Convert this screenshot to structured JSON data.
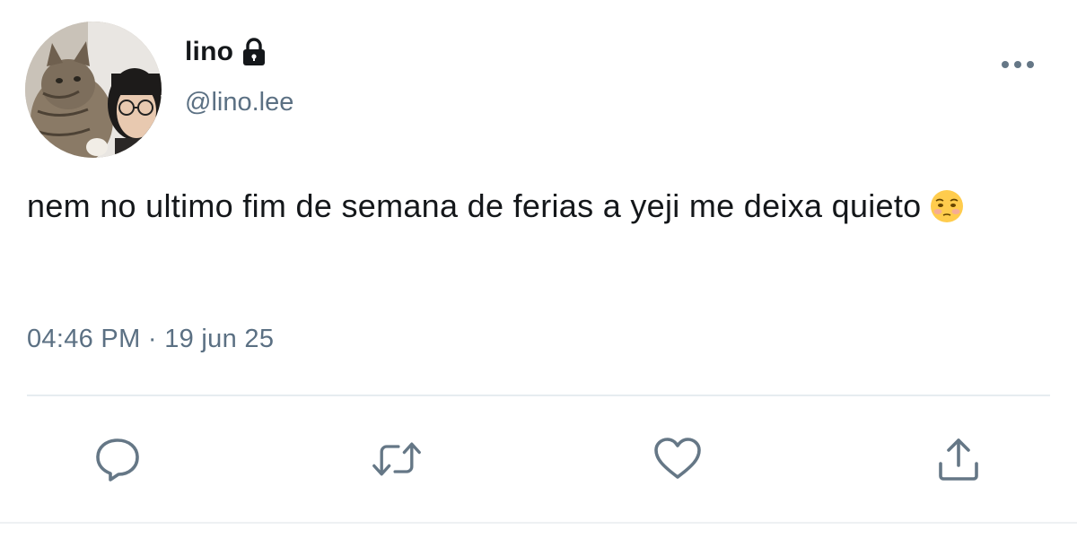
{
  "author": {
    "display_name": "lino",
    "handle": "@lino.lee",
    "protected_icon": "lock-icon",
    "avatar_icon": "avatar-photo"
  },
  "tweet": {
    "text": "nem no ultimo fim de semana de ferias a yeji me deixa quieto",
    "emoji": "flushed-face-emoji",
    "time": "04:46 PM",
    "separator": "·",
    "date": "19 jun 25"
  },
  "actions": {
    "more_icon": "more-icon",
    "reply_icon": "reply-icon",
    "retweet_icon": "retweet-icon",
    "like_icon": "heart-icon",
    "share_icon": "share-icon"
  },
  "colors": {
    "text": "#14171a",
    "secondary": "#5b7083",
    "icon": "#657786",
    "divider": "#e6ecf0"
  }
}
